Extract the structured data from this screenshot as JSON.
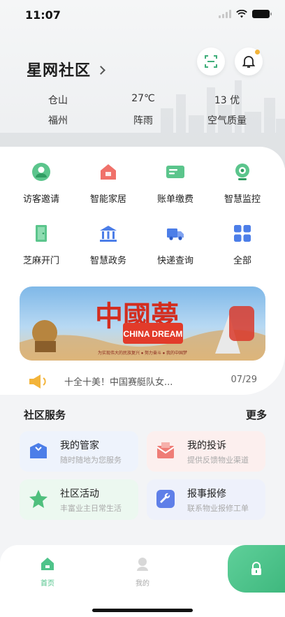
{
  "status_bar": {
    "time": "11:07"
  },
  "header": {
    "community_name": "星网社区",
    "weather": {
      "location_top": "仓山",
      "location_bottom": "福州",
      "temperature": "27℃",
      "condition": "阵雨",
      "aqi": "13 优",
      "aqi_label": "空气质量"
    }
  },
  "services_grid": [
    {
      "label": "访客邀请",
      "icon": "visitor-icon"
    },
    {
      "label": "智能家居",
      "icon": "smart-home-icon"
    },
    {
      "label": "账单缴费",
      "icon": "bill-icon"
    },
    {
      "label": "智慧监控",
      "icon": "camera-icon"
    },
    {
      "label": "芝麻开门",
      "icon": "door-icon"
    },
    {
      "label": "智慧政务",
      "icon": "government-icon"
    },
    {
      "label": "快递查询",
      "icon": "delivery-truck-icon"
    },
    {
      "label": "全部",
      "icon": "all-grid-icon"
    }
  ],
  "banner": {
    "headline": "中國夢",
    "headline_en": "CHINA DREAM",
    "tagline": "为实现伟大的民族复兴 ● 努力奋斗 ● 我的中国梦"
  },
  "notice": {
    "text": "十全十美！中国赛艇队女...",
    "date": "07/29"
  },
  "community_services": {
    "title": "社区服务",
    "more_label": "更多",
    "cards": [
      {
        "title": "我的管家",
        "subtitle": "随时随地为您服务",
        "icon": "butler-icon",
        "bg": "#eef3fc",
        "accent": "#4c7ee8"
      },
      {
        "title": "我的投诉",
        "subtitle": "提供反馈物业渠道",
        "icon": "complaint-icon",
        "bg": "#fcefee",
        "accent": "#ef7d77"
      },
      {
        "title": "社区活动",
        "subtitle": "丰富业主日常生活",
        "icon": "activity-star-icon",
        "bg": "#ecf8f0",
        "accent": "#4fbf7d"
      },
      {
        "title": "报事报修",
        "subtitle": "联系物业报修工单",
        "icon": "repair-wrench-icon",
        "bg": "#eef1fb",
        "accent": "#5f7fe8"
      }
    ]
  },
  "tabbar": {
    "tabs": [
      {
        "label": "首页",
        "icon": "home-icon",
        "active": true
      },
      {
        "label": "我的",
        "icon": "profile-icon",
        "active": false
      }
    ]
  },
  "colors": {
    "primary_green": "#4fc38a",
    "accent_orange": "#f3b43a"
  }
}
